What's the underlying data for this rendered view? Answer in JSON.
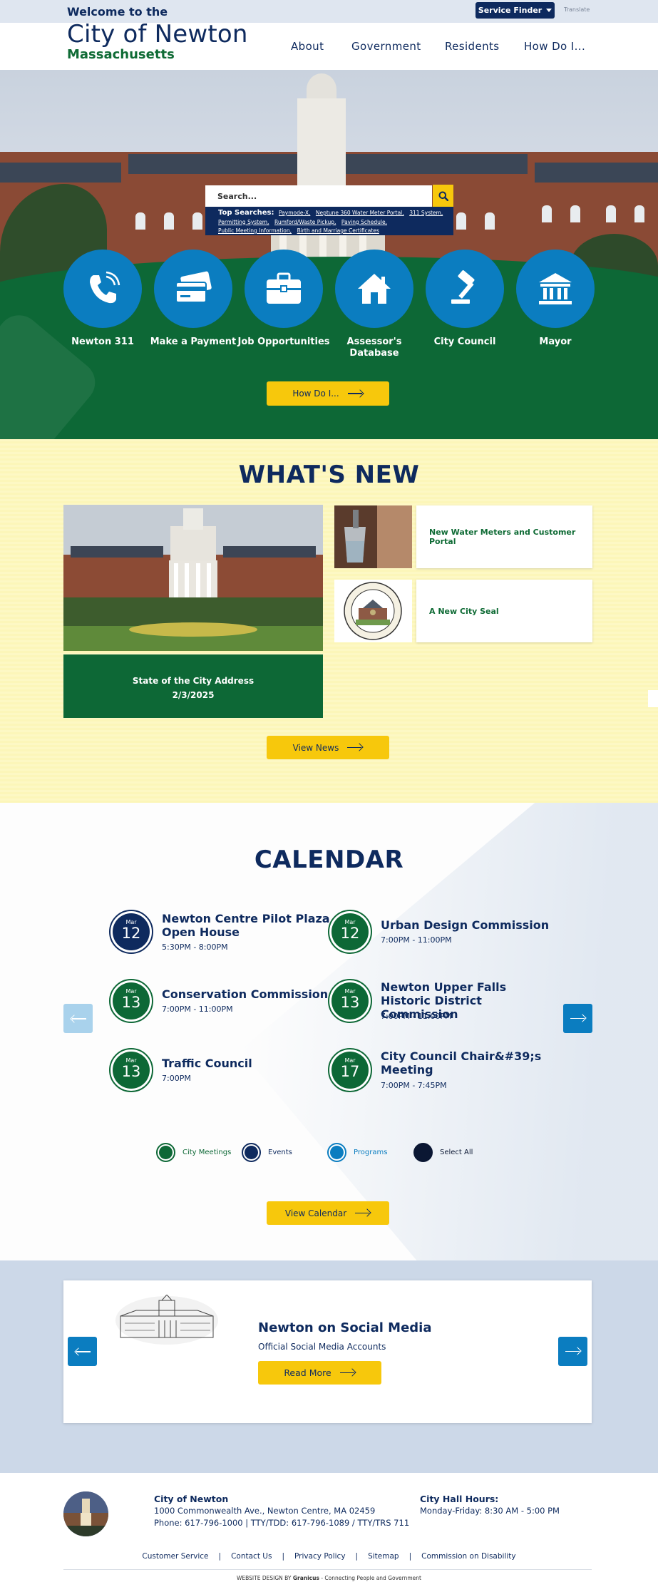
{
  "header": {
    "welcome": "Welcome to the",
    "city": "City of Newton",
    "state": "Massachusetts",
    "service_finder": "Service Finder",
    "translate": "Translate",
    "nav": [
      "About",
      "Government",
      "Residents",
      "How Do I..."
    ]
  },
  "hero": {
    "search_placeholder": "Search...",
    "top_searches_label": "Top Searches:",
    "top_searches": [
      "Paymode-X,",
      "Neptune 360 Water Meter Portal,",
      "311 System,",
      "Permitting System,",
      "Rumford/Waste Pickup,",
      "Paving Schedule,",
      "Public Meeting Information,",
      "Birth and Marriage Certificates"
    ],
    "quick_links": [
      {
        "label": "Newton 311",
        "icon": "phone-icon"
      },
      {
        "label": "Make a Payment",
        "icon": "credit-card-icon"
      },
      {
        "label": "Job Opportunities",
        "icon": "briefcase-icon"
      },
      {
        "label": "Assessor's Database",
        "icon": "house-icon"
      },
      {
        "label": "City Council",
        "icon": "gavel-icon"
      },
      {
        "label": "Mayor",
        "icon": "city-hall-icon"
      }
    ],
    "how_do_i": "How Do I..."
  },
  "news": {
    "title": "WHAT'S NEW",
    "featured_line1": "State of the City Address",
    "featured_line2": "2/3/2025",
    "items": [
      "New Water Meters and Customer Portal",
      "A New City Seal"
    ],
    "view_news": "View News"
  },
  "calendar": {
    "title": "CALENDAR",
    "events": [
      {
        "month": "Mar",
        "day": "12",
        "title": "Newton Centre Pilot Plaza Open House",
        "time": "5:30PM - 8:00PM",
        "type": "event"
      },
      {
        "month": "Mar",
        "day": "12",
        "title": "Urban Design Commission",
        "time": "7:00PM - 11:00PM",
        "type": "meeting"
      },
      {
        "month": "Mar",
        "day": "13",
        "title": "Conservation Commission",
        "time": "7:00PM - 11:00PM",
        "type": "meeting"
      },
      {
        "month": "Mar",
        "day": "13",
        "title": "Newton Upper Falls Historic District Commission",
        "time": "7:00PM - 11:00PM",
        "type": "meeting"
      },
      {
        "month": "Mar",
        "day": "13",
        "title": "Traffic Council",
        "time": "7:00PM",
        "type": "meeting"
      },
      {
        "month": "Mar",
        "day": "17",
        "title": "City Council Chair&#39;s Meeting",
        "time": "7:00PM - 7:45PM",
        "type": "meeting"
      }
    ],
    "legend": [
      {
        "label": "City Meetings",
        "color": "#0d6836"
      },
      {
        "label": "Events",
        "color": "#0e2a5e"
      },
      {
        "label": "Programs",
        "color": "#0b7dc0"
      },
      {
        "label": "Select All",
        "color": "#0b1733"
      }
    ],
    "view_calendar": "View Calendar"
  },
  "social": {
    "title": "Newton on Social Media",
    "subtitle": "Official Social Media Accounts",
    "read_more": "Read More"
  },
  "footer": {
    "name": "City of Newton",
    "address": "1000 Commonwealth Ave., Newton Centre, MA 02459",
    "phone": "Phone: 617-796-1000 | TTY/TDD: 617-796-1089 / TTY/TRS 711",
    "hours_title": "City Hall Hours:",
    "hours": "Monday-Friday: 8:30 AM - 5:00 PM",
    "links": [
      "Customer Service",
      "Contact Us",
      "Privacy Policy",
      "Sitemap",
      "Commission on Disability"
    ],
    "credit_prefix": "WEBSITE DESIGN BY",
    "credit_brand": "Granicus",
    "credit_suffix": "- Connecting People and Government"
  },
  "colors": {
    "navy": "#0e2a5e",
    "green": "#0d6836",
    "blue": "#0b7dc0",
    "yellow": "#f7c80c"
  }
}
